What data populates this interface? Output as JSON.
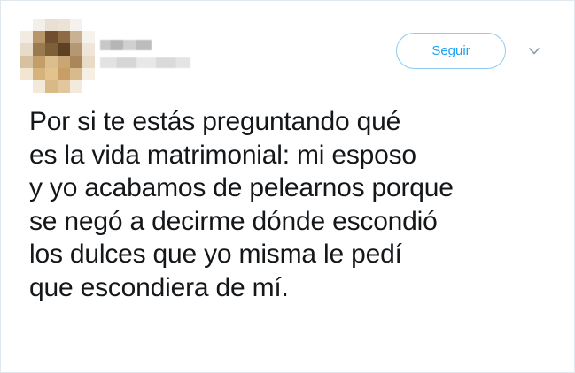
{
  "header": {
    "follow_label": "Seguir",
    "chevron_icon": "chevron-down-icon"
  },
  "tweet": {
    "lines": [
      "Por si te estás preguntando qué",
      "es la vida matrimonial: mi esposo",
      "y yo acabamos de pelearnos porque",
      "se negó a decirme dónde escondió",
      "los dulces que yo misma le pedí",
      "que escondiera de mí."
    ]
  },
  "colors": {
    "accent": "#1da1f2",
    "text": "#14171a",
    "border": "#e1e8ed"
  }
}
